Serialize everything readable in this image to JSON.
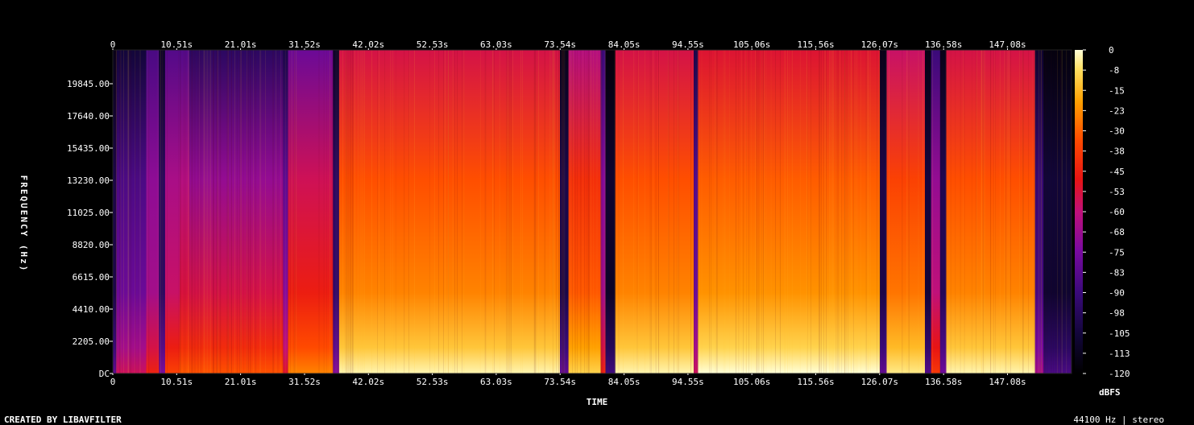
{
  "chart_data": {
    "type": "heatmap",
    "title": "",
    "xlabel": "TIME",
    "ylabel": "FREQUENCY (Hz)",
    "x_ticks": [
      "0",
      "10.51s",
      "21.01s",
      "31.52s",
      "42.02s",
      "52.53s",
      "63.03s",
      "73.54s",
      "84.05s",
      "94.55s",
      "105.06s",
      "115.56s",
      "126.07s",
      "136.58s",
      "147.08s"
    ],
    "y_ticks": [
      "DC",
      "2205.00",
      "4410.00",
      "6615.00",
      "8820.00",
      "11025.00",
      "13230.00",
      "15435.00",
      "17640.00",
      "19845.00"
    ],
    "y_range_hz": [
      0,
      22050
    ],
    "colorbar": {
      "label": "dBFS",
      "ticks": [
        "0",
        "-8",
        "-15",
        "-23",
        "-30",
        "-38",
        "-45",
        "-53",
        "-60",
        "-68",
        "-75",
        "-83",
        "-90",
        "-98",
        "-105",
        "-113",
        "-120"
      ],
      "range": [
        -120,
        0
      ]
    },
    "segments": [
      {
        "t0": 0.0,
        "t1": 0.6,
        "level": 0.15,
        "hf": 0.05
      },
      {
        "t0": 0.6,
        "t1": 5.5,
        "level": 0.35,
        "hf": 0.12
      },
      {
        "t0": 5.5,
        "t1": 7.6,
        "level": 0.45,
        "hf": 0.28
      },
      {
        "t0": 7.6,
        "t1": 8.6,
        "level": 0.2,
        "hf": 0.08
      },
      {
        "t0": 8.6,
        "t1": 11.0,
        "level": 0.52,
        "hf": 0.3
      },
      {
        "t0": 11.0,
        "t1": 12.6,
        "level": 0.56,
        "hf": 0.3
      },
      {
        "t0": 12.6,
        "t1": 28.0,
        "level": 0.55,
        "hf": 0.2
      },
      {
        "t0": 28.0,
        "t1": 28.8,
        "level": 0.4,
        "hf": 0.15
      },
      {
        "t0": 28.8,
        "t1": 36.2,
        "level": 0.62,
        "hf": 0.35
      },
      {
        "t0": 36.2,
        "t1": 37.2,
        "level": 0.22,
        "hf": 0.08
      },
      {
        "t0": 37.2,
        "t1": 73.5,
        "level": 0.8,
        "hf": 0.55
      },
      {
        "t0": 73.5,
        "t1": 74.9,
        "level": 0.15,
        "hf": 0.05
      },
      {
        "t0": 74.9,
        "t1": 80.2,
        "level": 0.74,
        "hf": 0.48
      },
      {
        "t0": 80.2,
        "t1": 81.0,
        "level": 0.45,
        "hf": 0.25
      },
      {
        "t0": 81.0,
        "t1": 82.6,
        "level": 0.08,
        "hf": 0.02
      },
      {
        "t0": 82.6,
        "t1": 95.5,
        "level": 0.8,
        "hf": 0.55
      },
      {
        "t0": 95.5,
        "t1": 96.2,
        "level": 0.35,
        "hf": 0.15
      },
      {
        "t0": 96.2,
        "t1": 126.1,
        "level": 0.82,
        "hf": 0.57
      },
      {
        "t0": 126.1,
        "t1": 127.2,
        "level": 0.15,
        "hf": 0.05
      },
      {
        "t0": 127.2,
        "t1": 133.5,
        "level": 0.78,
        "hf": 0.52
      },
      {
        "t0": 133.5,
        "t1": 134.5,
        "level": 0.12,
        "hf": 0.04
      },
      {
        "t0": 134.5,
        "t1": 136.0,
        "level": 0.5,
        "hf": 0.25
      },
      {
        "t0": 136.0,
        "t1": 137.0,
        "level": 0.18,
        "hf": 0.05
      },
      {
        "t0": 137.0,
        "t1": 151.6,
        "level": 0.8,
        "hf": 0.55
      },
      {
        "t0": 151.6,
        "t1": 153.0,
        "level": 0.28,
        "hf": 0.1
      },
      {
        "t0": 153.0,
        "t1": 157.6,
        "level": 0.1,
        "hf": 0.03
      }
    ],
    "duration_s": 157.6
  },
  "footer": {
    "left": "CREATED BY LIBAVFILTER",
    "right": "44100 Hz | stereo"
  }
}
